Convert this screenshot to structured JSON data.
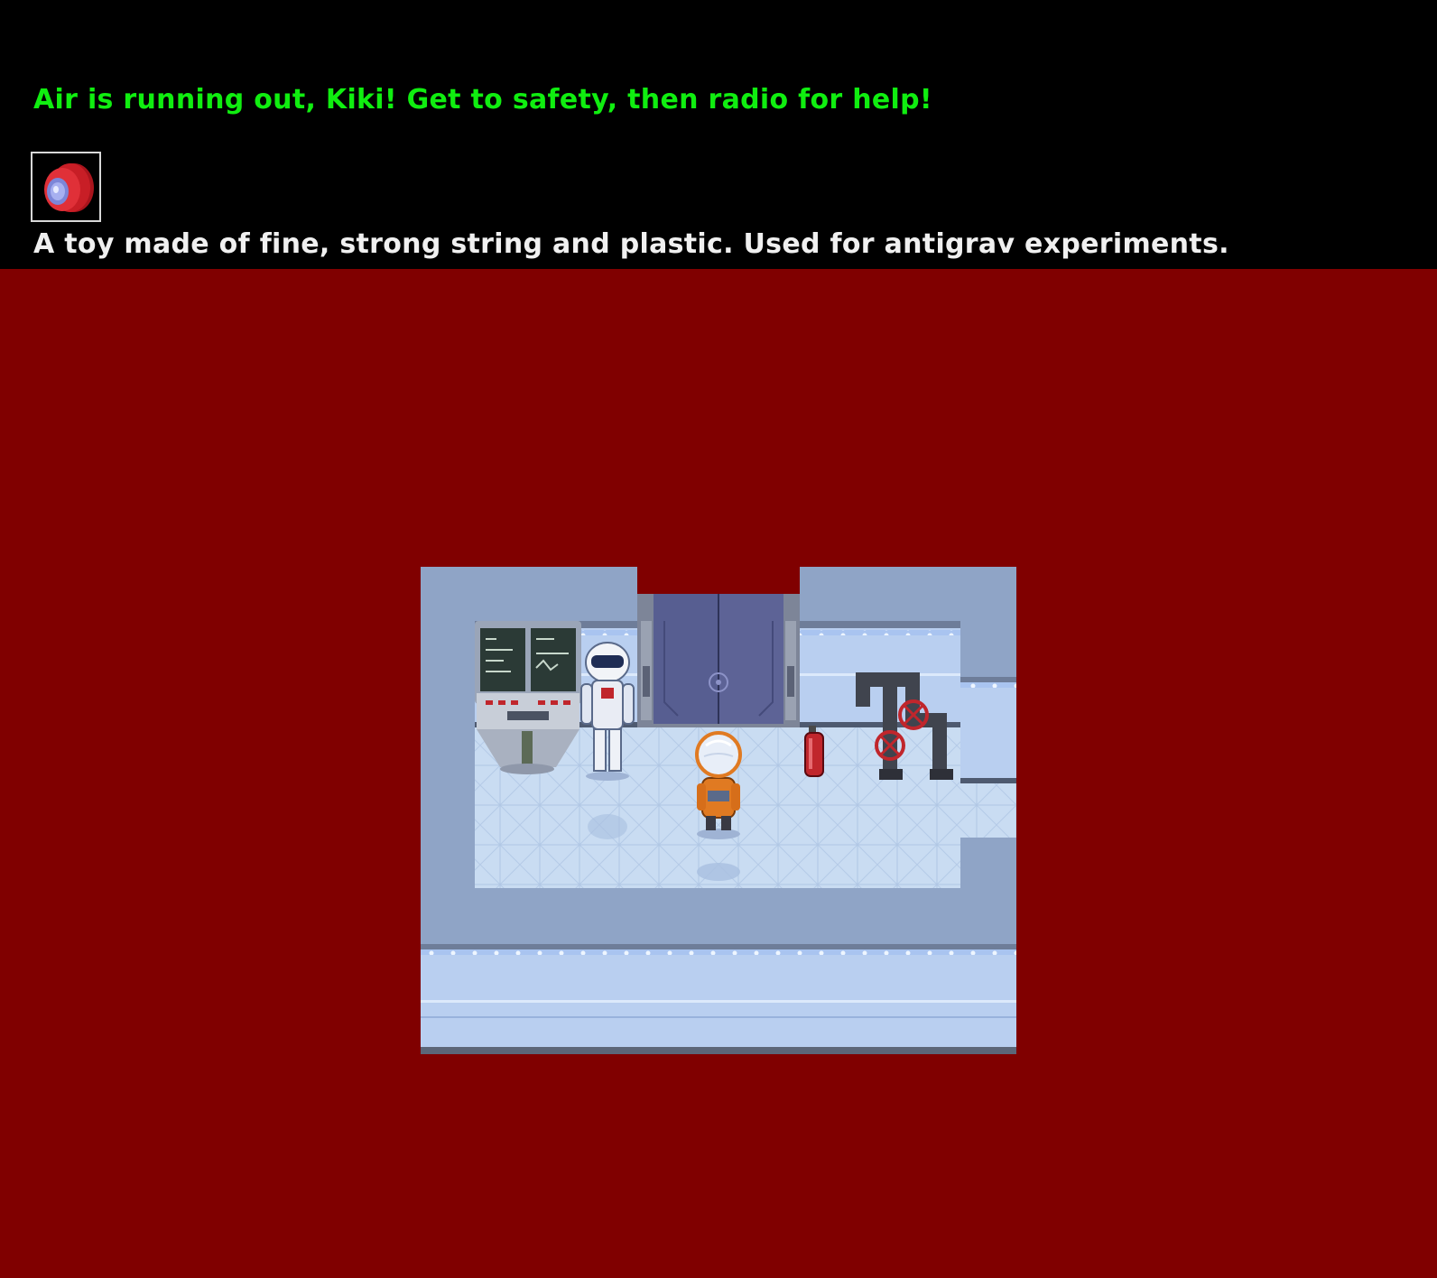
{
  "hud": {
    "objective": "Air is running out, Kiki! Get to safety, then radio for help!",
    "objective_color": "#10ee10",
    "selected_item": {
      "icon": "yoyo-icon",
      "description": "A toy made of fine, strong string and plastic. Used for antigrav experiments."
    }
  },
  "scene": {
    "background_color": "#800000",
    "room": "space-station-room",
    "objects": [
      "control-console",
      "robot-suit",
      "sliding-door",
      "player-kiki",
      "fire-extinguisher",
      "pipe-valves"
    ]
  }
}
